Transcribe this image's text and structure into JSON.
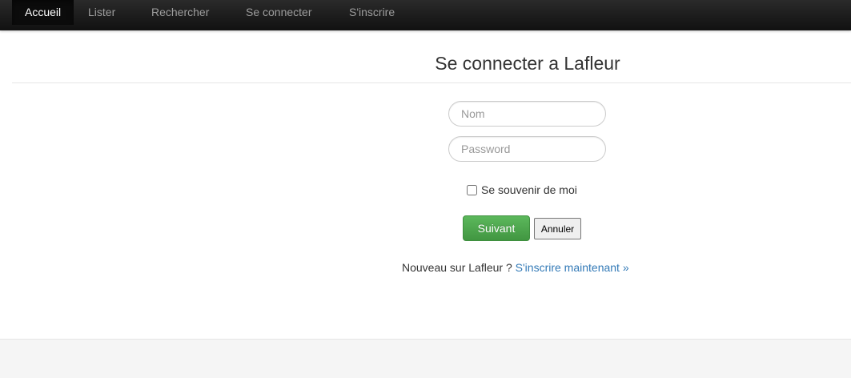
{
  "nav": {
    "items": [
      {
        "label": "Accueil",
        "active": true
      },
      {
        "label": "Lister",
        "active": false
      },
      {
        "label": "Rechercher",
        "active": false
      },
      {
        "label": "Se connecter",
        "active": false
      },
      {
        "label": "S'inscrire",
        "active": false
      }
    ]
  },
  "login": {
    "title": "Se connecter a Lafleur",
    "name_placeholder": "Nom",
    "name_value": "",
    "password_placeholder": "Password",
    "password_value": "",
    "remember_label": "Se souvenir de moi",
    "remember_checked": false,
    "next_button": "Suivant",
    "cancel_button": "Annuler",
    "signup_prompt": "Nouveau sur Lafleur ?",
    "signup_link": "S'inscrire maintenant »"
  },
  "colors": {
    "navbar": "#1a1a1a",
    "nav_text": "#9d9d9d",
    "primary_button": "#5cb85c",
    "link": "#337ab7",
    "footer": "#f5f5f5"
  }
}
